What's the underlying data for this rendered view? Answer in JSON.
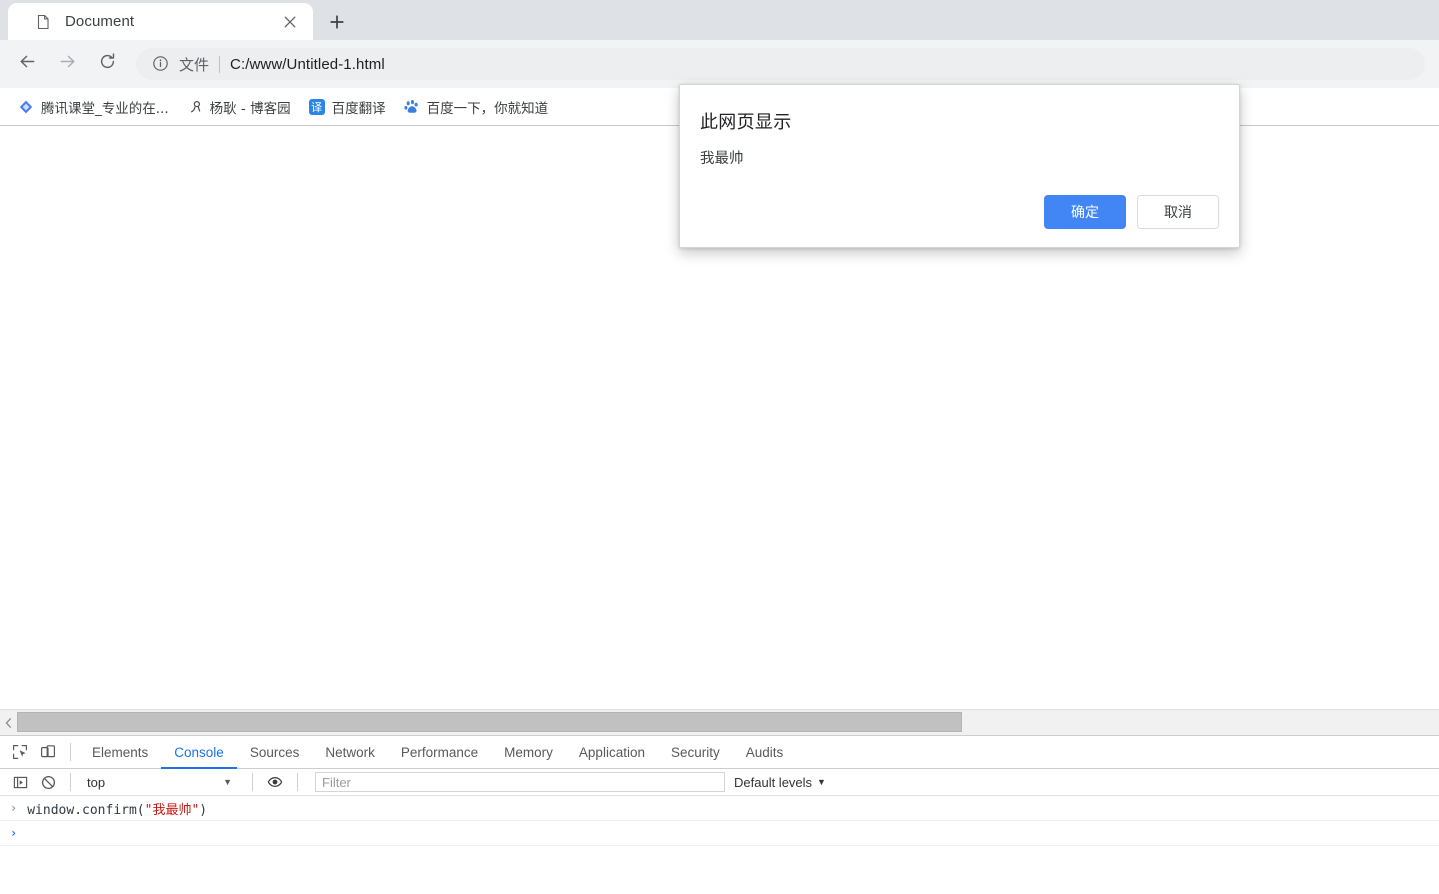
{
  "browser": {
    "tab": {
      "title": "Document",
      "favicon_icon": "page-icon",
      "close_icon": "close-icon"
    },
    "new_tab_icon": "plus-icon",
    "toolbar": {
      "back_icon": "arrow-left-icon",
      "forward_icon": "arrow-right-icon",
      "reload_icon": "reload-icon",
      "omnibox": {
        "info_icon": "info-circle-icon",
        "scheme_label": "文件",
        "url": "C:/www/Untitled-1.html"
      }
    },
    "bookmarks": [
      {
        "label": "腾讯课堂_专业的在...",
        "icon": "tencent-classroom-icon",
        "icon_color": "#4a7cf0",
        "icon_glyph": "◆"
      },
      {
        "label": "杨耿 - 博客园",
        "icon": "cnblogs-icon",
        "icon_color": "#ffffff",
        "icon_glyph": "ዓ"
      },
      {
        "label": "百度翻译",
        "icon": "baidu-translate-icon",
        "icon_color": "#2b85e4",
        "icon_glyph": "译"
      },
      {
        "label": "百度一下，你就知道",
        "icon": "baidu-icon",
        "icon_color": "#ffffff",
        "icon_glyph": "熊"
      }
    ]
  },
  "dialog": {
    "title": "此网页显示",
    "message": "我最帅",
    "confirm_label": "确定",
    "cancel_label": "取消",
    "primary_color": "#4285f4"
  },
  "scrollbar": {
    "left_arrow_icon": "chevron-left-icon"
  },
  "devtools": {
    "inspect_icon": "inspect-element-icon",
    "device_icon": "device-toolbar-icon",
    "tabs": [
      {
        "label": "Elements",
        "active": false
      },
      {
        "label": "Console",
        "active": true
      },
      {
        "label": "Sources",
        "active": false
      },
      {
        "label": "Network",
        "active": false
      },
      {
        "label": "Performance",
        "active": false
      },
      {
        "label": "Memory",
        "active": false
      },
      {
        "label": "Application",
        "active": false
      },
      {
        "label": "Security",
        "active": false
      },
      {
        "label": "Audits",
        "active": false
      }
    ],
    "console_toolbar": {
      "sidebar_icon": "console-sidebar-icon",
      "clear_icon": "clear-console-icon",
      "context_value": "top",
      "context_caret": "▼",
      "eye_icon": "live-expression-eye-icon",
      "filter_placeholder": "Filter",
      "levels_label": "Default levels",
      "levels_caret": "▼"
    },
    "console_lines": [
      {
        "chevron": "›",
        "type": "input",
        "parts": [
          {
            "text": "window.confirm(",
            "kind": "plain"
          },
          {
            "text": "\"我最帅\"",
            "kind": "string"
          },
          {
            "text": ")",
            "kind": "plain"
          }
        ]
      },
      {
        "chevron": "›",
        "type": "prompt",
        "parts": []
      }
    ]
  }
}
